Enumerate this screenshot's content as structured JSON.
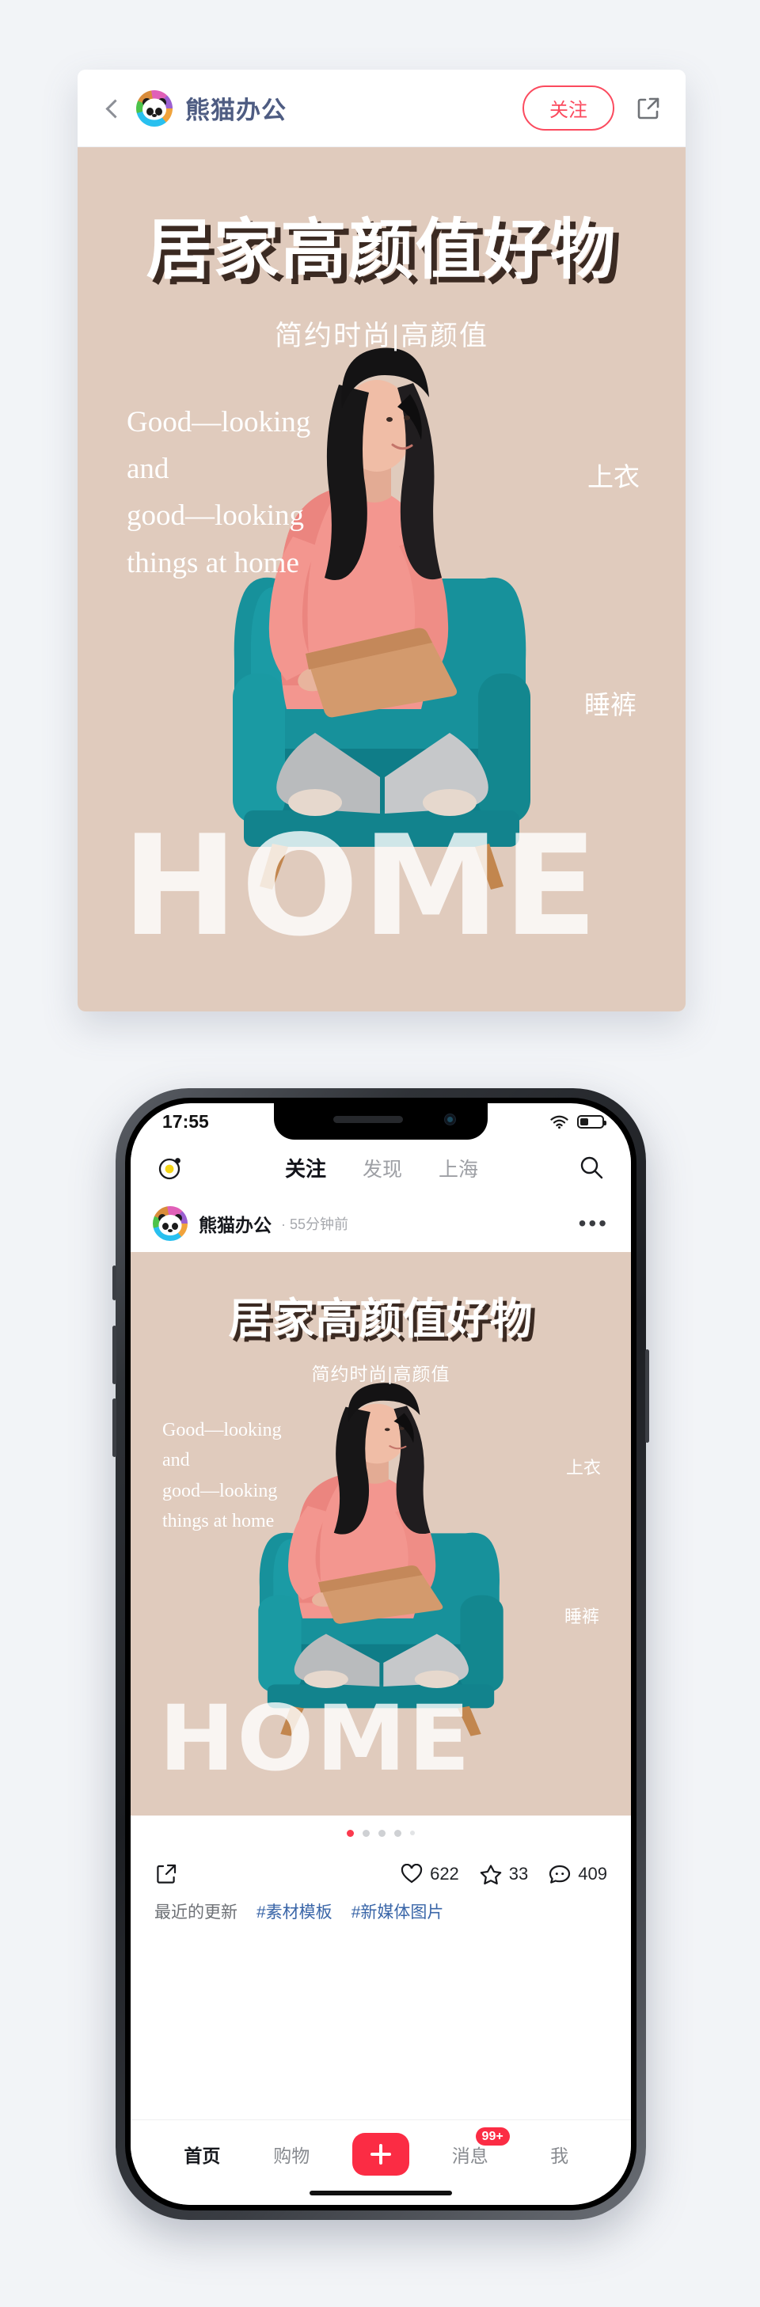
{
  "top_card": {
    "header": {
      "back_icon": "chevron-left-icon",
      "logo_icon": "panda-logo-icon",
      "brand": "熊猫办公",
      "follow_label": "关注",
      "share_icon": "share-external-icon"
    },
    "poster": {
      "title": "居家高颜值好物",
      "subtitle": "简约时尚|高颜值",
      "serif_lines": [
        "Good—looking",
        "and",
        "good—looking",
        "things at home"
      ],
      "watermark": "HOME",
      "tag_top": "上衣",
      "tag_bottom": "睡裤",
      "bg_color": "#e0cbbd",
      "chair_color": "#17919b",
      "shirt_color": "#f3968f"
    }
  },
  "phone": {
    "status_bar": {
      "time": "17:55",
      "wifi_icon": "wifi-icon",
      "battery_icon": "battery-icon"
    },
    "topbar": {
      "camera_icon": "camera-icon",
      "search_icon": "search-icon",
      "tabs": [
        {
          "label": "关注",
          "active": true
        },
        {
          "label": "发现",
          "active": false
        },
        {
          "label": "上海",
          "active": false
        }
      ]
    },
    "post": {
      "avatar_icon": "panda-avatar-icon",
      "author": "熊猫办公",
      "time": "· 55分钟前",
      "more_icon": "more-dots-icon",
      "poster": {
        "title": "居家高颜值好物",
        "subtitle": "简约时尚|高颜值",
        "serif_lines": [
          "Good—looking",
          "and",
          "good—looking",
          "things at home"
        ],
        "watermark": "HOME",
        "tag_top": "上衣",
        "tag_bottom": "睡裤"
      },
      "carousel": {
        "total": 5,
        "active_index": 0,
        "active_color": "#fb3a4e"
      },
      "actions": {
        "share_icon": "share-external-icon",
        "like": {
          "icon": "heart-icon",
          "count": "622"
        },
        "star": {
          "icon": "star-icon",
          "count": "33"
        },
        "comment": {
          "icon": "comment-icon",
          "count": "409"
        }
      },
      "tags": [
        {
          "label": "最近的更新",
          "link": false
        },
        {
          "label": "#素材模板",
          "link": true
        },
        {
          "label": "#新媒体图片",
          "link": true
        }
      ]
    },
    "bottom_nav": {
      "items": [
        {
          "label": "首页",
          "active": true
        },
        {
          "label": "购物",
          "active": false
        },
        {
          "label": "消息",
          "active": false,
          "badge": "99+"
        },
        {
          "label": "我",
          "active": false
        }
      ],
      "plus_icon": "plus-icon",
      "plus_color": "#fb2c44"
    }
  }
}
